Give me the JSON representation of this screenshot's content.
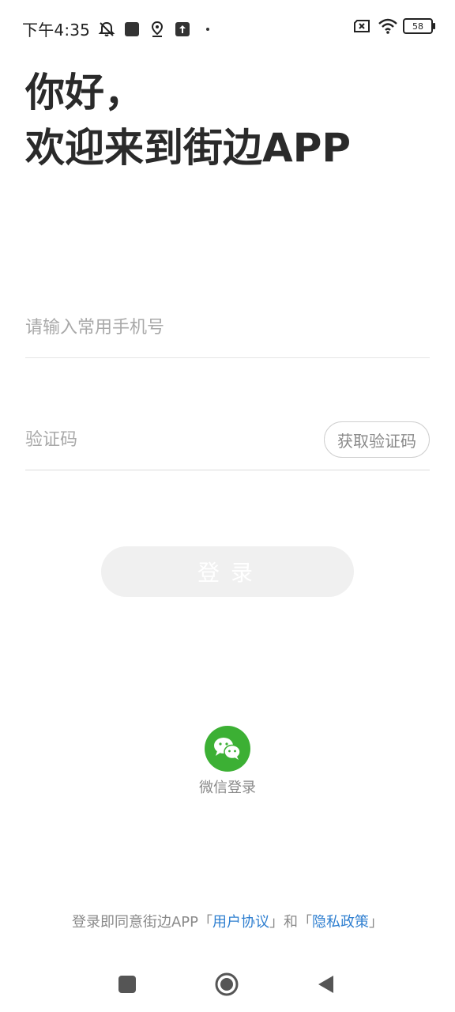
{
  "status_bar": {
    "time": "下午4:35",
    "battery": "58",
    "icons": [
      "mute-icon",
      "app-square-icon",
      "location-icon",
      "upload-icon",
      "dot-icon",
      "sim-x-icon",
      "wifi-icon",
      "battery-icon"
    ]
  },
  "greeting": {
    "line1": "你好，",
    "line2": "欢迎来到街边APP"
  },
  "phone_input": {
    "placeholder": "请输入常用手机号",
    "value": ""
  },
  "code_input": {
    "placeholder": "验证码",
    "value": ""
  },
  "get_code_label": "获取验证码",
  "login_label": "登录",
  "wechat": {
    "label": "微信登录",
    "color": "#3cb034"
  },
  "agreement": {
    "prefix": "登录即同意街边APP「",
    "user_agreement": "用户协议",
    "middle": "」和「",
    "privacy_policy": "隐私政策",
    "suffix": "」",
    "link_color": "#2f7fd0"
  },
  "nav_bar": {
    "icons": [
      "recents-icon",
      "home-icon",
      "back-icon"
    ]
  }
}
